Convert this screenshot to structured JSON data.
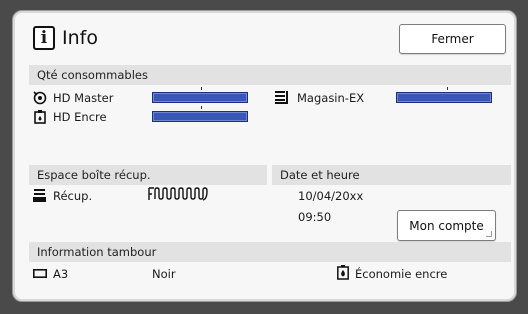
{
  "dialog": {
    "title": "Info",
    "close_label": "Fermer"
  },
  "consumables": {
    "header": "Qté consommables",
    "items": [
      {
        "label": "HD Master",
        "icon": "master-roll-icon",
        "level": 1.0
      },
      {
        "label": "HD Encre",
        "icon": "ink-cartridge-icon",
        "level": 1.0
      },
      {
        "label": "Magasin-EX",
        "icon": "paper-stack-icon",
        "level": 1.0
      }
    ],
    "bar_color": "#3a57b8"
  },
  "disposal": {
    "header": "Espace boîte récup.",
    "label": "Récup.",
    "icon": "disposal-box-icon",
    "meter_icon": "disposal-meter-icon"
  },
  "datetime": {
    "header": "Date et heure",
    "date": "10/04/20xx",
    "time": "09:50",
    "account_label": "Mon compte"
  },
  "drum": {
    "header": "Information tambour",
    "size": "A3",
    "size_icon": "drum-size-icon",
    "color": "Noir",
    "mode_icon": "ink-saving-icon",
    "mode": "Économie encre"
  }
}
